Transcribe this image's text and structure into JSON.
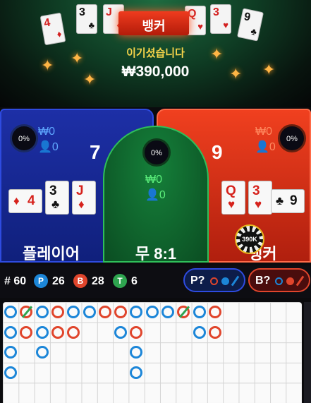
{
  "result": {
    "banner_label": "뱅커",
    "message": "이기셨습니다",
    "amount": "₩390,000"
  },
  "top_cards": [
    {
      "rank": "4",
      "suit": "♦",
      "red": true
    },
    {
      "rank": "3",
      "suit": "♣",
      "red": false
    },
    {
      "rank": "J",
      "suit": "♦",
      "red": true
    },
    {
      "rank": "Q",
      "suit": "♥",
      "red": true
    },
    {
      "rank": "3",
      "suit": "♥",
      "red": true
    },
    {
      "rank": "9",
      "suit": "♣",
      "red": false
    }
  ],
  "player": {
    "label": "플레이어",
    "percent": "0%",
    "bet_amount": "₩0",
    "users": "0",
    "score": "7",
    "cards": [
      {
        "rank": "4",
        "suit": "♦",
        "red": true
      },
      {
        "rank": "3",
        "suit": "♣",
        "red": false
      },
      {
        "rank": "J",
        "suit": "♦",
        "red": true
      }
    ]
  },
  "tie": {
    "label": "무 8:1",
    "percent": "0%",
    "bet_amount": "₩0",
    "users": "0"
  },
  "banker": {
    "label": "뱅커",
    "percent": "0%",
    "bet_amount": "₩0",
    "users": "0",
    "score": "9",
    "chip": "390K",
    "cards": [
      {
        "rank": "Q",
        "suit": "♥",
        "red": true
      },
      {
        "rank": "3",
        "suit": "♥",
        "red": true
      },
      {
        "rank": "9",
        "suit": "♣",
        "red": false
      }
    ]
  },
  "stats": {
    "total_label": "# 60",
    "player_letter": "P",
    "player_count": "26",
    "banker_letter": "B",
    "banker_count": "28",
    "tie_letter": "T",
    "tie_count": "6"
  },
  "predictions": {
    "player_label": "P?",
    "banker_label": "B?"
  },
  "colors": {
    "player": "#1c86d8",
    "banker": "#e0452c",
    "tie": "#2ea44f"
  },
  "road": [
    [
      "p",
      "b",
      "p",
      "b",
      "p",
      "p",
      "b",
      "b",
      "p",
      "p",
      "p",
      "b",
      "p",
      "b"
    ],
    [
      "p",
      "b",
      "p",
      "b",
      "b",
      "",
      "",
      "p",
      "b",
      "",
      "",
      "",
      "p",
      "b"
    ],
    [
      "p",
      "",
      "p",
      "",
      "",
      "",
      "",
      "",
      "p",
      "",
      "",
      "",
      "",
      ""
    ],
    [
      "p",
      "",
      "",
      "",
      "",
      "",
      "",
      "",
      "p",
      "",
      "",
      "",
      "",
      ""
    ]
  ],
  "road_ties": [
    [
      0,
      1
    ],
    [
      0,
      11
    ]
  ]
}
